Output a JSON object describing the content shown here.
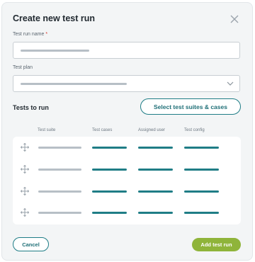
{
  "dialog": {
    "title": "Create new test run",
    "close_icon": "close-icon"
  },
  "form": {
    "name_label": "Test run name",
    "name_required_marker": "*",
    "plan_label": "Test plan",
    "plan_dropdown_icon": "chevron-down-icon"
  },
  "tests": {
    "section_title": "Tests to run",
    "select_button": "Select test suites & cases",
    "columns": [
      "Test suite",
      "Test cases",
      "Assigned user",
      "Test config"
    ],
    "drag_icon": "drag-move-icon",
    "row_count": 4
  },
  "footer": {
    "cancel_label": "Cancel",
    "add_label": "Add test run"
  },
  "colors": {
    "accent_teal": "#1f7d86",
    "placeholder_grey": "#b7bfc6",
    "add_green": "#8fb43a",
    "required_red": "#d93025"
  }
}
